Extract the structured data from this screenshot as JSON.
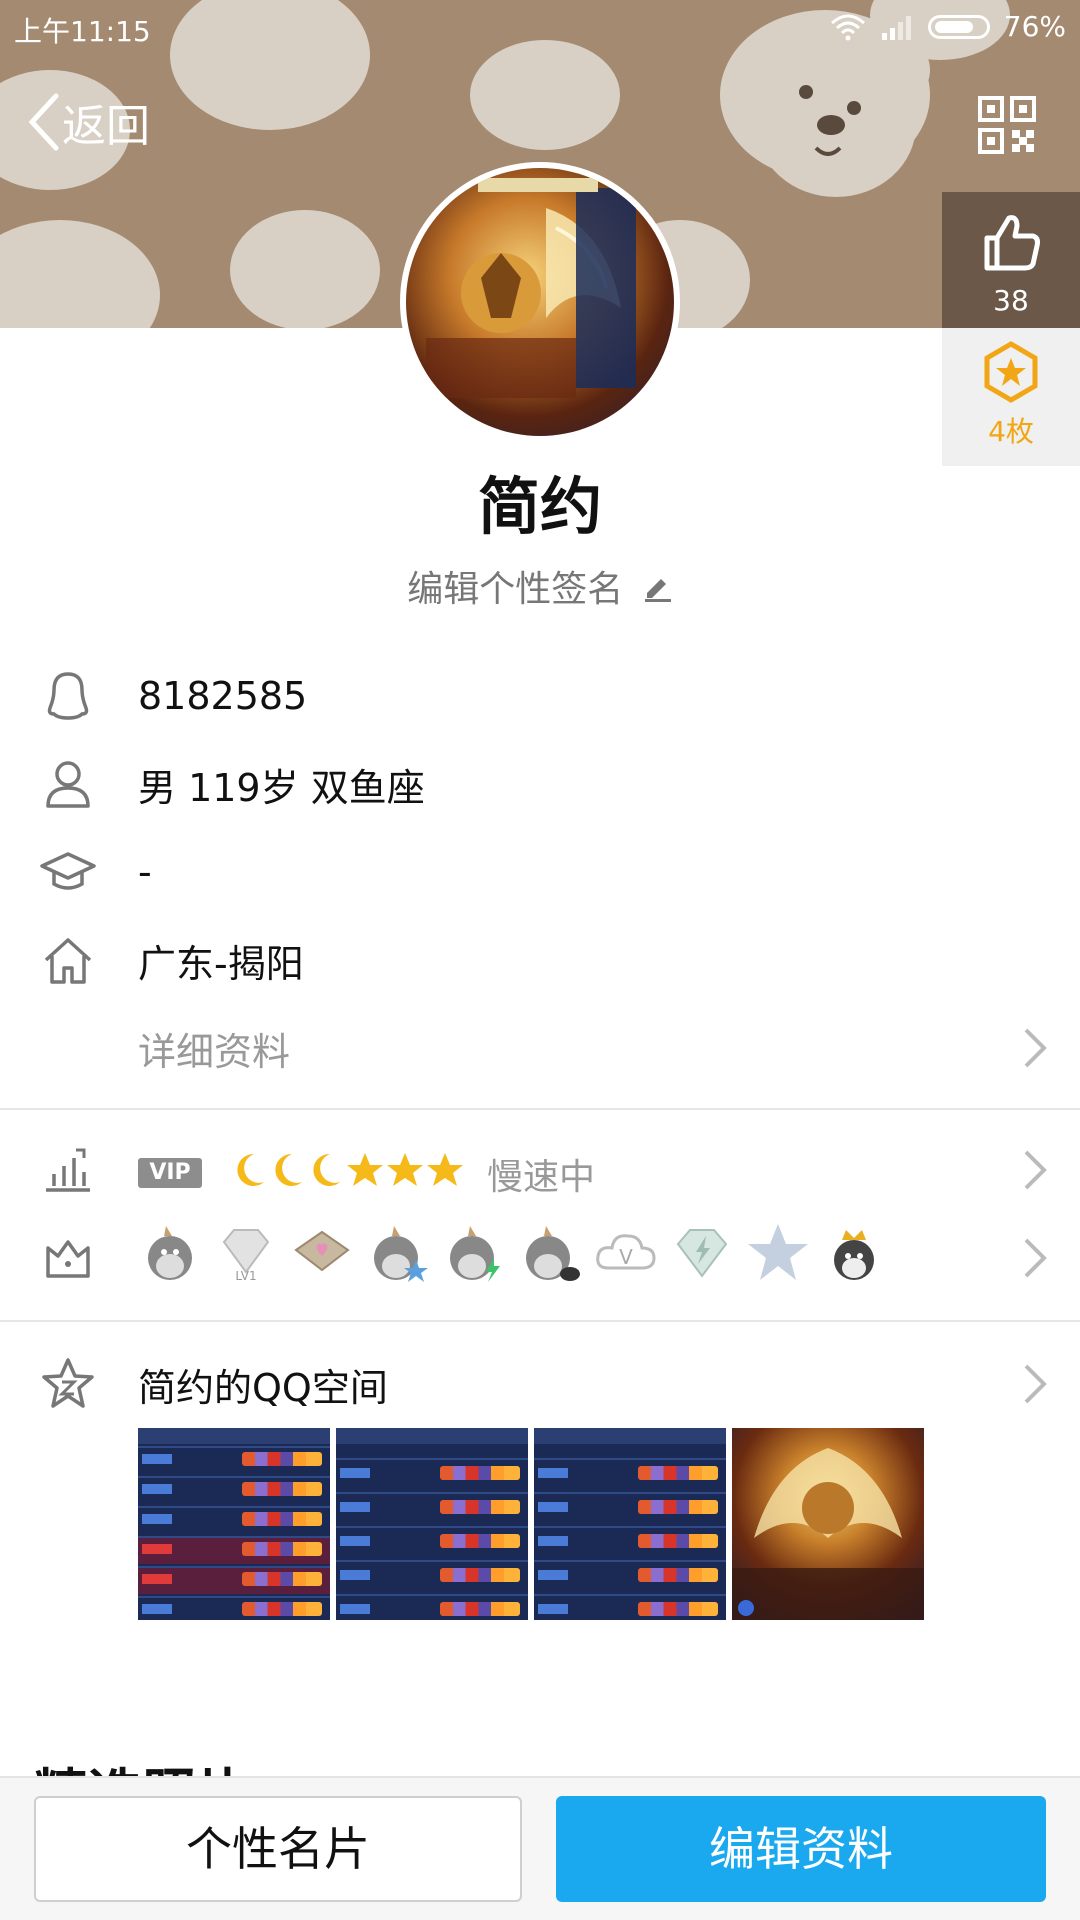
{
  "status_bar": {
    "time": "上午11:15",
    "battery": "76%"
  },
  "header": {
    "back_label": "返回",
    "like_count": "38",
    "medal_count": "4枚"
  },
  "profile": {
    "nickname": "简约",
    "signature": "编辑个性签名"
  },
  "info": {
    "qq_number": "8182585",
    "basic": "男  119岁  双鱼座",
    "school": "-",
    "hometown": "广东-揭阳",
    "details_label": "详细资料"
  },
  "level": {
    "vip_label": "VIP",
    "status": "慢速中",
    "icons": [
      "moon",
      "moon",
      "moon",
      "star",
      "star",
      "star"
    ]
  },
  "badges": [
    "qq-penguin-flag",
    "diamond-lv1",
    "diamond-heart",
    "qq-penguin-star",
    "qq-penguin-bolt",
    "qq-penguin-bird",
    "cloud-v",
    "diamond-bolt",
    "star-badge",
    "crown-penguin"
  ],
  "qzone": {
    "title": "简约的QQ空间"
  },
  "section_peek": "精选照片",
  "bottom": {
    "card_label": "个性名片",
    "edit_label": "编辑资料"
  },
  "colors": {
    "cover_bg": "#a48a70",
    "accent_blue": "#1aa8ee",
    "medal_orange": "#f2a515"
  }
}
